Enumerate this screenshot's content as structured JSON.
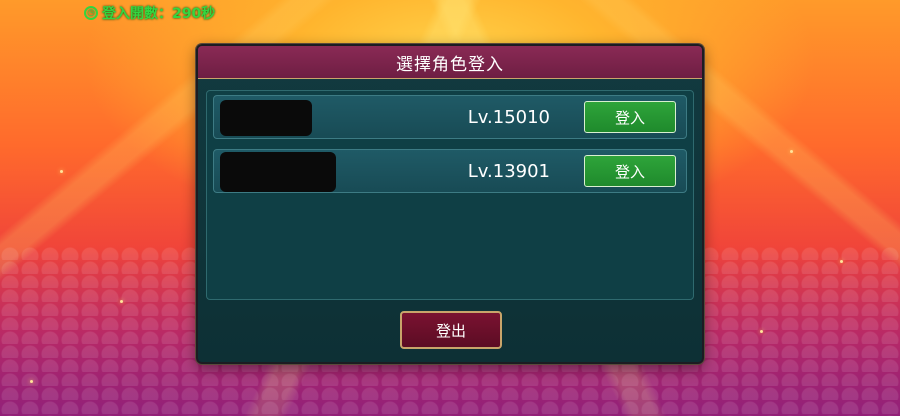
{
  "header": {
    "login_count_label": "登入開數：290秒"
  },
  "dialog": {
    "title": "選擇角色登入",
    "characters": [
      {
        "name_hidden": true,
        "level": "Lv.15010",
        "login_label": "登入"
      },
      {
        "name_hidden": true,
        "level": "Lv.13901",
        "login_label": "登入"
      }
    ],
    "logout_label": "登出"
  },
  "colors": {
    "accent_green": "#34d640",
    "title_bar": "#7a2448",
    "panel_bg": "#0f3f45",
    "login_button": "#27963a",
    "logout_button": "#6e1030"
  },
  "icons": {
    "counter": "timer-icon"
  }
}
